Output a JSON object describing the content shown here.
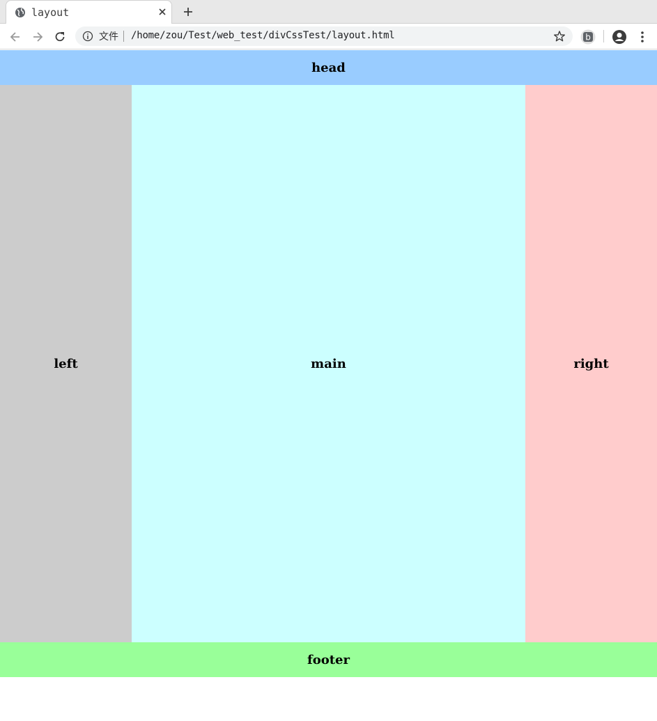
{
  "browser": {
    "tab_title": "layout",
    "scheme_label": "文件",
    "url": "/home/zou/Test/web_test/divCssTest/layout.html",
    "extension_letter": "b"
  },
  "layout": {
    "head": {
      "label": "head",
      "color": "#99ccff"
    },
    "left": {
      "label": "left",
      "color": "#cccccc"
    },
    "main": {
      "label": "main",
      "color": "#ccffff"
    },
    "right": {
      "label": "right",
      "color": "#ffcccc"
    },
    "footer": {
      "label": "footer",
      "color": "#99ff99"
    }
  }
}
